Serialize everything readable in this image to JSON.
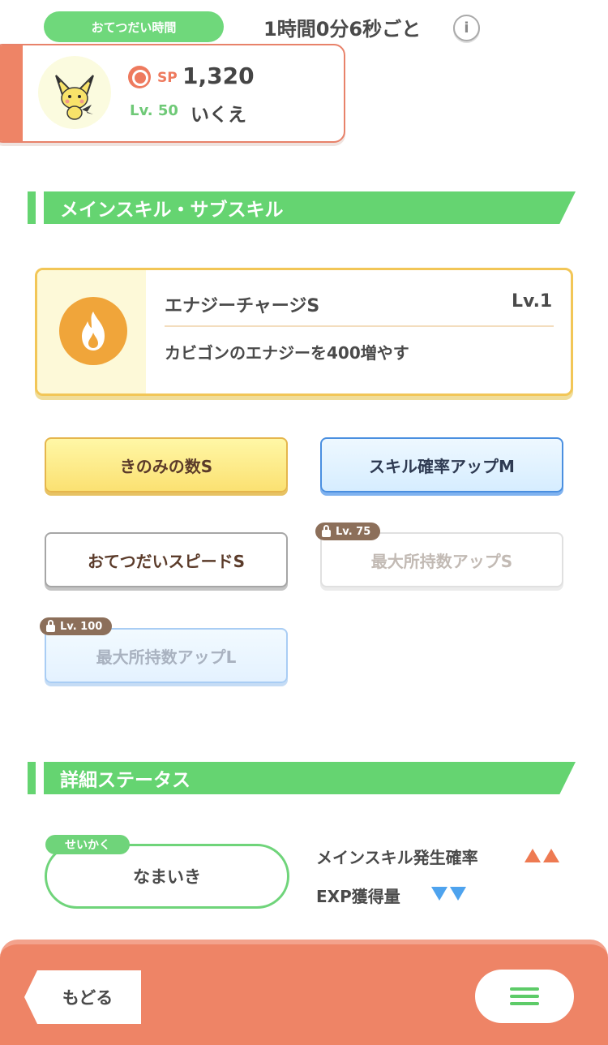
{
  "header": {
    "help_label": "おてつだい時間",
    "help_interval": "1時間0分6秒ごと",
    "info_icon": "i"
  },
  "pokemon": {
    "sp_label": "SP",
    "sp_value": "1,320",
    "level_label": "Lv. 50",
    "name": "いくえ",
    "avatar_icon": "pichu-icon"
  },
  "skills_section": {
    "title": "メインスキル・サブスキル",
    "main_skill": {
      "name": "エナジーチャージS",
      "level": "Lv.1",
      "description": "カビゴンのエナジーを400増やす",
      "icon": "flame-icon",
      "color": "#f0a53a"
    },
    "sub_skills": [
      {
        "label": "きのみの数S",
        "style": "gold",
        "locked": false
      },
      {
        "label": "スキル確率アップM",
        "style": "blue",
        "locked": false
      },
      {
        "label": "おてつだいスピードS",
        "style": "white",
        "locked": false
      },
      {
        "label": "最大所持数アップS",
        "style": "white",
        "locked": true,
        "lock_level": "Lv. 75"
      },
      {
        "label": "最大所持数アップL",
        "style": "blue",
        "locked": true,
        "lock_level": "Lv. 100"
      }
    ]
  },
  "status_section": {
    "title": "詳細ステータス",
    "nature_tag": "せいかく",
    "nature": "なまいき",
    "effects": [
      {
        "label": "メインスキル発生確率",
        "direction": "up",
        "count": 2,
        "color": "#ee7a52"
      },
      {
        "label": "EXP獲得量",
        "direction": "down",
        "count": 2,
        "color": "#4ea3ee"
      }
    ]
  },
  "footer": {
    "back_label": "もどる",
    "menu_icon": "hamburger-menu-icon"
  },
  "colors": {
    "accent_green": "#65d471",
    "accent_salmon": "#ee8466",
    "gold": "#f2c657"
  }
}
